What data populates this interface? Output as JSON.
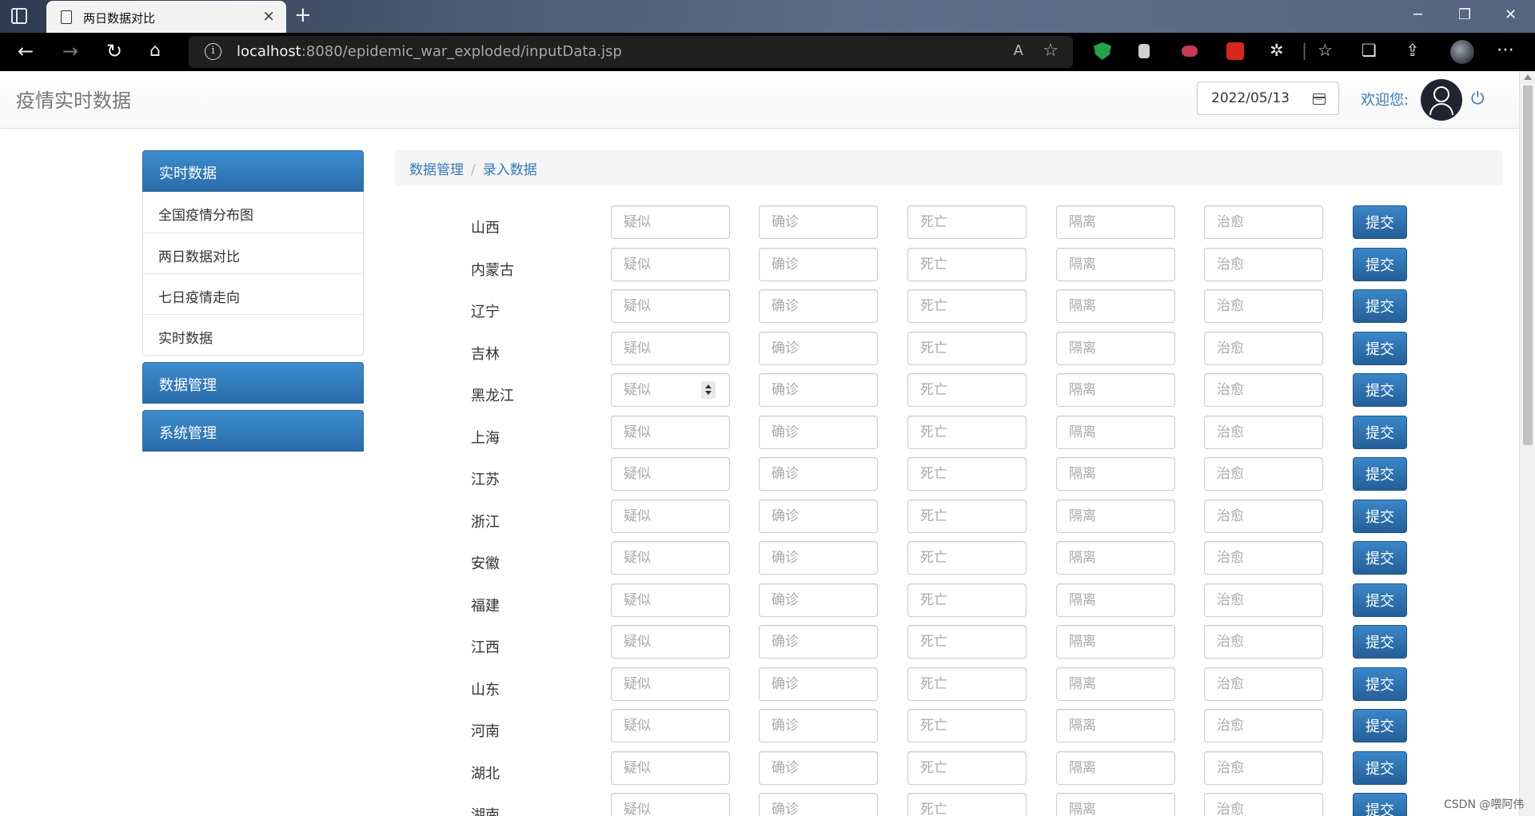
{
  "browser": {
    "tab_title": "两日数据对比",
    "tab_close": "×",
    "new_tab": "+",
    "url_host": "localhost",
    "url_rest": ":8080/epidemic_war_exploded/inputData.jsp",
    "info_glyph": "i",
    "icons": [
      "back-icon",
      "forward-icon",
      "refresh-icon",
      "home-icon",
      "read-aloud-icon",
      "add-favorite-icon",
      "shield-extension-icon",
      "reader-extension-icon",
      "screen-capture-extension-icon",
      "pdf-extension-icon",
      "extensions-icon",
      "favorites-icon",
      "collections-icon",
      "share-icon",
      "profile-avatar",
      "more-icon"
    ],
    "window_controls": [
      "─",
      "❐",
      "✕"
    ]
  },
  "header": {
    "brand": "疫情实时数据",
    "date": "2022/05/13",
    "welcome": "欢迎您:"
  },
  "sidebar": {
    "panel1_title": "实时数据",
    "items": [
      "全国疫情分布图",
      "两日数据对比",
      "七日疫情走向",
      "实时数据"
    ],
    "panel2_title": "数据管理",
    "panel3_title": "系统管理"
  },
  "breadcrumb": {
    "root": "数据管理",
    "separator": "/",
    "current": "录入数据"
  },
  "form": {
    "placeholders": {
      "suspected": "疑似",
      "confirmed": "确诊",
      "dead": "死亡",
      "isolated": "隔离",
      "cured": "治愈"
    },
    "submit_label": "提交",
    "provinces": [
      "山西",
      "内蒙古",
      "辽宁",
      "吉林",
      "黑龙江",
      "上海",
      "江苏",
      "浙江",
      "安徽",
      "福建",
      "江西",
      "山东",
      "河南",
      "湖北",
      "湖南"
    ]
  },
  "watermark": "CSDN @喂阿伟",
  "colors": {
    "accent": "#337ab7",
    "panel_header": "#2a6ba8",
    "button": "#245f97",
    "chrome_bar": "#000000"
  }
}
